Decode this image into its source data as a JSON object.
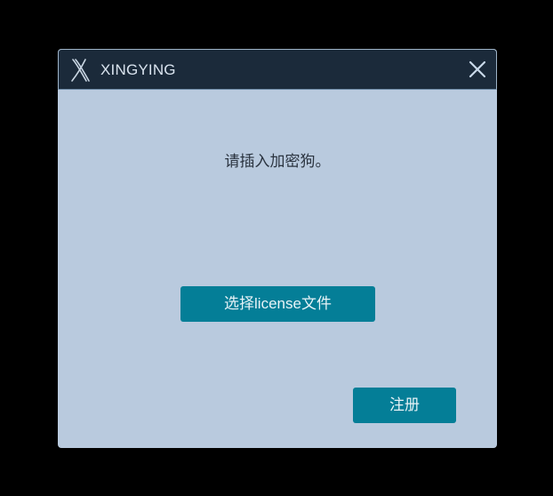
{
  "window": {
    "title": "XINGYING",
    "logo_icon": "xingying-logo-icon",
    "close_icon": "close-icon"
  },
  "dialog": {
    "message": "请插入加密狗。",
    "select_license_label": "选择license文件",
    "register_label": "注册"
  },
  "colors": {
    "background": "#000000",
    "titlebar": "#1b2a3a",
    "dialog_body": "#b9cade",
    "button": "#047e97",
    "button_text": "#e8f3f7",
    "title_text": "#d9e3ee"
  }
}
